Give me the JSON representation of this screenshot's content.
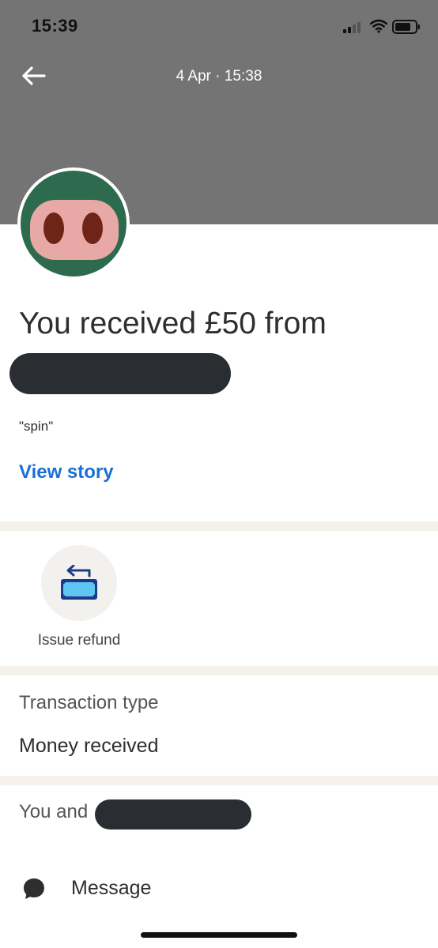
{
  "status_bar": {
    "time": "15:39"
  },
  "header": {
    "date": "4 Apr · 15:38"
  },
  "transaction": {
    "headline": "You received £50 from",
    "note": "\"spin\"",
    "view_story": "View story"
  },
  "actions": {
    "refund_label": "Issue refund"
  },
  "details": {
    "type_label": "Transaction type",
    "type_value": "Money received"
  },
  "contact": {
    "you_and": "You and",
    "message_label": "Message"
  },
  "colors": {
    "header_bg": "#747474",
    "link": "#1a6fd6",
    "avatar_green": "#2e6b4e",
    "avatar_pink": "#e7a8a6",
    "divider": "#f5f2ec"
  },
  "icons": [
    "back-arrow-icon",
    "signal-icon",
    "wifi-icon",
    "battery-icon",
    "refund-icon",
    "message-icon"
  ]
}
